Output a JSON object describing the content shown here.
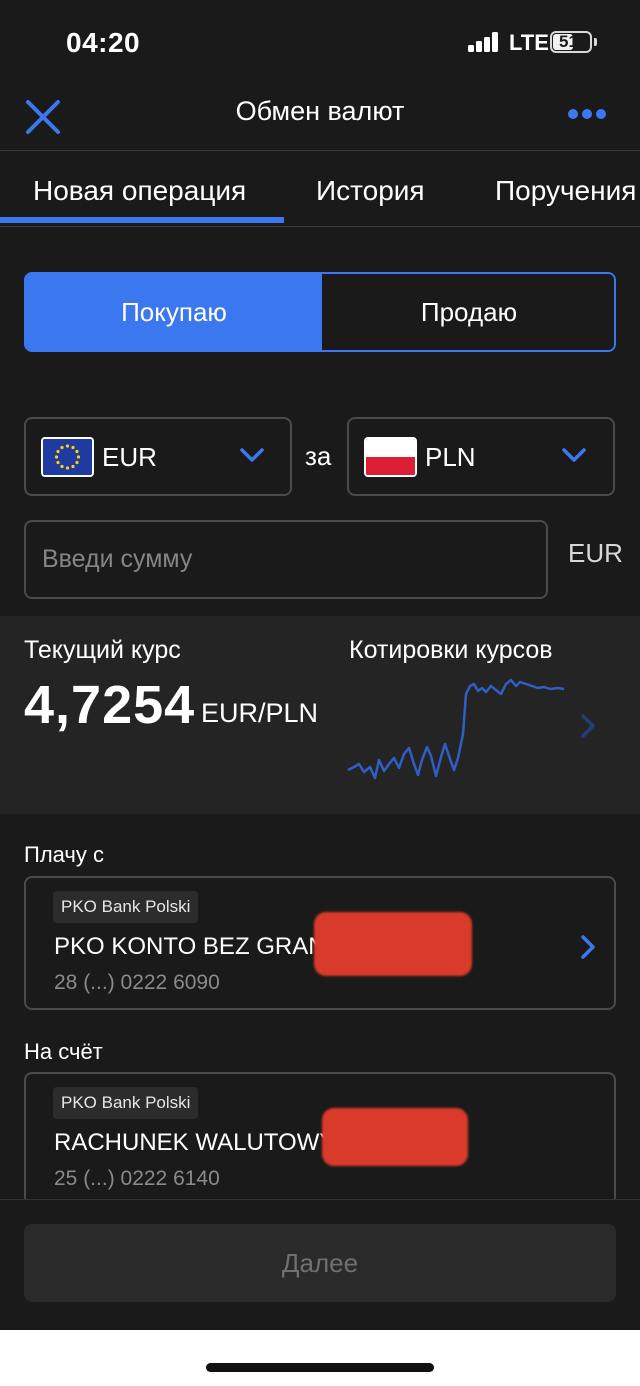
{
  "status_bar": {
    "time": "04:20",
    "network": "LTE",
    "battery": "51"
  },
  "header": {
    "title": "Обмен валют"
  },
  "tabs": [
    {
      "label": "Новая операция",
      "active": true
    },
    {
      "label": "История",
      "active": false
    },
    {
      "label": "Поручения",
      "active": false
    }
  ],
  "mode_toggle": {
    "buy": "Покупаю",
    "sell": "Продаю",
    "selected": "buy"
  },
  "exchange": {
    "from_currency": "EUR",
    "connector": "за",
    "to_currency": "PLN",
    "amount_value": "",
    "amount_placeholder": "Введи сумму",
    "amount_currency": "EUR"
  },
  "rate": {
    "current_label": "Текущий курс",
    "value": "4,7254",
    "pair": "EUR/PLN",
    "quotes_label": "Котировки курсов"
  },
  "accounts": {
    "from_label": "Плачу с",
    "from": {
      "bank": "PKO Bank Polski",
      "name": "PKO KONTO BEZ GRAN...",
      "number": "28 (...) 0222 6090"
    },
    "to_label": "На счёт",
    "to": {
      "bank": "PKO Bank Polski",
      "name": "RACHUNEK WALUTOWY (",
      "number": "25 (...) 0222 6140"
    }
  },
  "footer": {
    "next_label": "Далее"
  },
  "colors": {
    "accent": "#3b78f0",
    "background": "#1a1a1a",
    "panel": "#242424",
    "redaction": "#d93a2a"
  },
  "icons": [
    "close-icon",
    "more-icon",
    "eu-flag-icon",
    "pl-flag-icon",
    "chevron-down-icon",
    "chevron-right-icon"
  ]
}
